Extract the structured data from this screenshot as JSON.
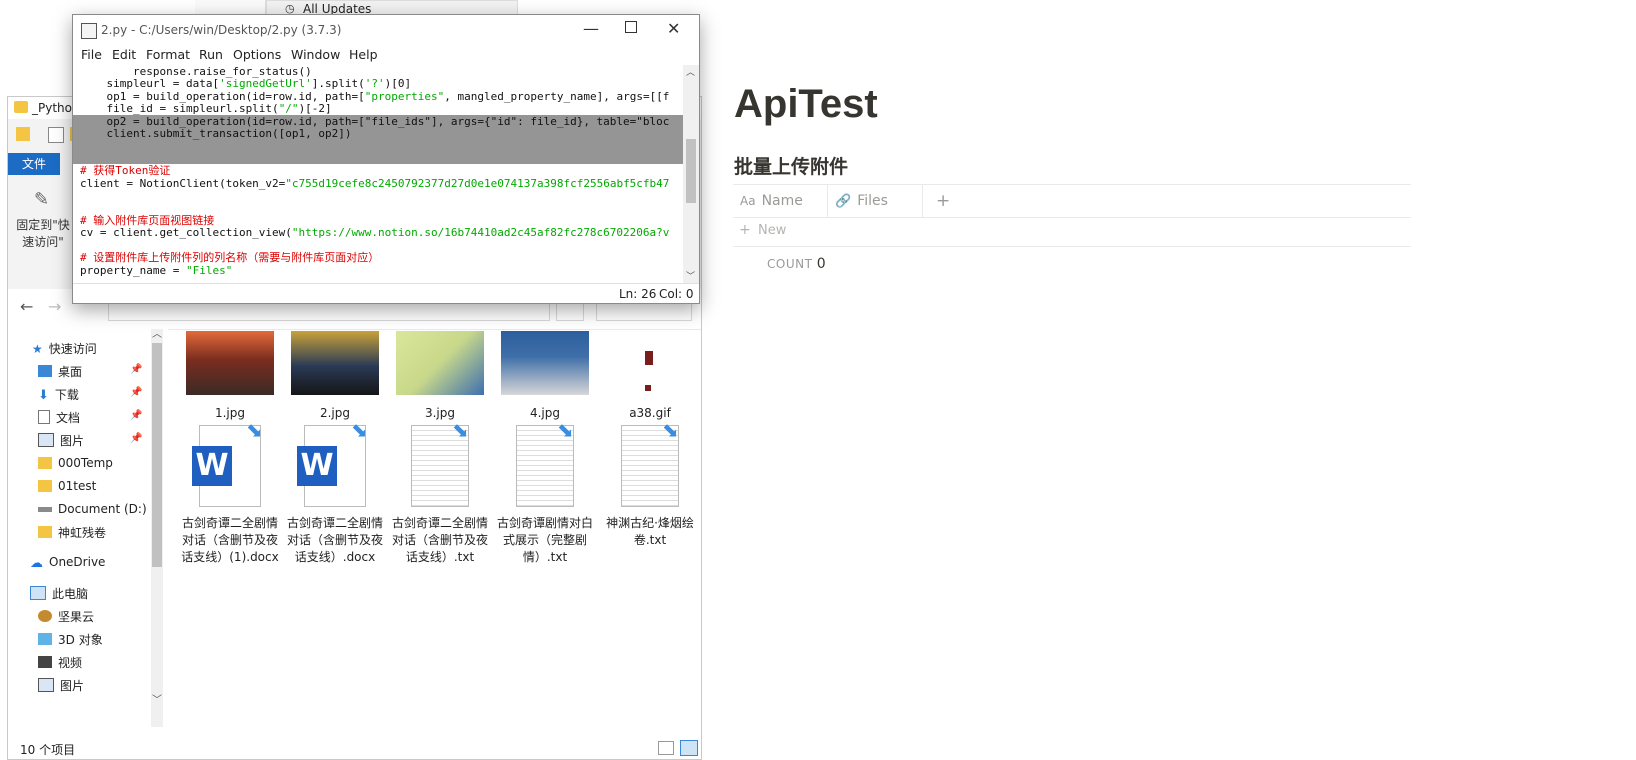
{
  "behind_window": {
    "title_fragments": [
      "All Updates",
      "_Python"
    ]
  },
  "explorer": {
    "ribbon": {
      "file_tab": "文件",
      "pin_quick_access": "固定到\"快速访问\""
    },
    "nav": {
      "quick_access": "快速访问",
      "desktop": "桌面",
      "downloads": "下载",
      "documents": "文档",
      "pictures": "图片",
      "folder_000temp": "000Temp",
      "folder_01test": "01test",
      "document_d": "Document (D:)",
      "shenhong": "神虹残卷",
      "onedrive": "OneDrive",
      "this_pc": "此电脑",
      "jianguoyun": "坚果云",
      "objects_3d": "3D 对象",
      "videos": "视频",
      "pictures2": "图片"
    },
    "files": [
      {
        "name": "1.jpg",
        "kind": "photo-icon",
        "color": "#7a2d1f"
      },
      {
        "name": "2.jpg",
        "kind": "photo-icon",
        "color": "#2a3a55"
      },
      {
        "name": "3.jpg",
        "kind": "photo-icon",
        "color": "#c8d88a"
      },
      {
        "name": "4.jpg",
        "kind": "photo-icon",
        "color": "#3f6fa8"
      },
      {
        "name": "a38.gif",
        "kind": "gif-icon",
        "color": "#7a1d1d"
      },
      {
        "name": "古剑奇谭二全剧情对话（含删节及夜话支线）(1).docx",
        "kind": "word-icon"
      },
      {
        "name": "古剑奇谭二全剧情对话（含删节及夜话支线）.docx",
        "kind": "word-icon"
      },
      {
        "name": "古剑奇谭二全剧情对话（含删节及夜话支线）.txt",
        "kind": "text-icon"
      },
      {
        "name": "古剑奇谭剧情对白式展示（完整剧情）.txt",
        "kind": "text-icon"
      },
      {
        "name": "神渊古纪·烽烟绘卷.txt",
        "kind": "text-icon"
      }
    ],
    "status": "10 个项目"
  },
  "idle": {
    "title": "2.py - C:/Users/win/Desktop/2.py (3.7.3)",
    "menu": [
      "File",
      "Edit",
      "Format",
      "Run",
      "Options",
      "Window",
      "Help"
    ],
    "code": [
      "        response.raise_for_status()",
      "    simpleurl = data['signedGetUrl'].split('?')[0]",
      "    op1 = build_operation(id=row.id, path=[\"properties\", mangled_property_name], args=[[f",
      "    file_id = simpleurl.split(\"/\")[-2]",
      "    op2 = build_operation(id=row.id, path=[\"file_ids\"], args={\"id\": file_id}, table=\"bloc",
      "    client.submit_transaction([op1, op2])",
      "",
      "",
      "# 获得Token验证",
      "client = NotionClient(token_v2=\"c755d19cefe8c2450792377d27d0e1e074137a398fcf2556abf5cfb47",
      "",
      "",
      "# 输入附件库页面视图链接",
      "cv = client.get_collection_view(\"https://www.notion.so/16b74410ad2c45af82fc278c6702206a?v",
      "",
      "# 设置附件库上传附件列的列名称（需要与附件库页面对应）",
      "property_name = \"Files\""
    ],
    "status_ln": "Ln: 26",
    "status_col": "Col: 0"
  },
  "notion": {
    "title": "ApiTest",
    "database_title": "批量上传附件",
    "columns": [
      {
        "label": "Name",
        "icon": "text-property-icon",
        "icon_text": "Aa"
      },
      {
        "label": "Files",
        "icon": "paperclip-icon",
        "icon_text": "⌀"
      }
    ],
    "add_column": "+",
    "new_row": "New",
    "count_label": "COUNT",
    "count_value": "0"
  }
}
